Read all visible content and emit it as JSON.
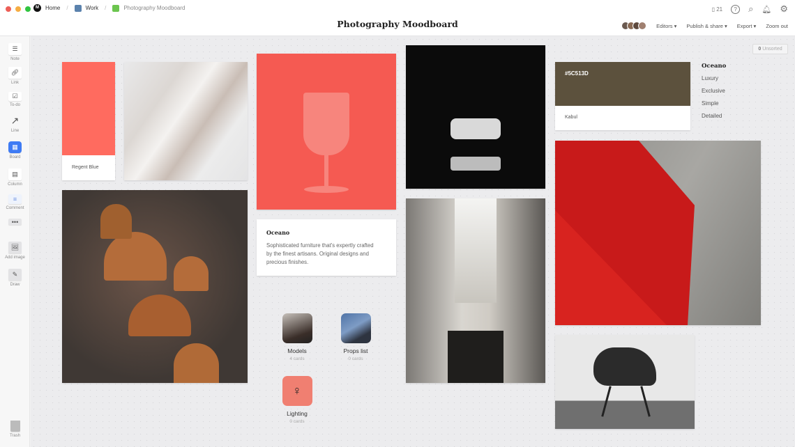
{
  "window": {
    "controls": [
      "close",
      "minimize",
      "maximize"
    ]
  },
  "breadcrumb": [
    {
      "label": "Home",
      "icon": "milanote-logo",
      "color": "#111111"
    },
    {
      "label": "Work",
      "icon": "board-square",
      "color": "#5b82ad"
    },
    {
      "label": "Photography Moodboard",
      "icon": "board-square",
      "color": "#6cc54f"
    }
  ],
  "header": {
    "title": "Photography Moodboard",
    "device_count": "21",
    "icons": [
      "mobile-icon",
      "help-icon",
      "search-icon",
      "bell-icon",
      "gear-icon"
    ],
    "menus": {
      "editors": "Editors",
      "publish": "Publish & share",
      "export": "Export",
      "zoom": "Zoom out"
    }
  },
  "sidebar": {
    "tools": [
      {
        "label": "Note",
        "icon": "note-icon"
      },
      {
        "label": "Link",
        "icon": "link-icon"
      },
      {
        "label": "To-do",
        "icon": "todo-icon"
      },
      {
        "label": "Line",
        "icon": "line-icon"
      },
      {
        "label": "Board",
        "icon": "board-icon"
      },
      {
        "label": "Column",
        "icon": "column-icon"
      },
      {
        "label": "Comment",
        "icon": "comment-icon"
      },
      {
        "label": "",
        "icon": "more-icon"
      },
      {
        "label": "Add image",
        "icon": "add-image-icon"
      },
      {
        "label": "Draw",
        "icon": "draw-icon"
      }
    ],
    "trash": "Trash"
  },
  "canvas": {
    "unsorted": {
      "count": "0",
      "label": "Unsorted"
    },
    "swatch1": {
      "name": "Regent Blue",
      "color": "#FF6B5F"
    },
    "swatch2": {
      "hex": "#5C513D",
      "name": "Kabul",
      "color": "#5C513D"
    },
    "note": {
      "title": "Oceano",
      "body": "Sophisticated furniture that's expertly crafted by the finest artisans. Original designs and precious finishes."
    },
    "tags": {
      "title": "Oceano",
      "items": [
        "Luxury",
        "Exclusive",
        "Simple",
        "Detailed"
      ]
    },
    "boards": [
      {
        "name": "Models",
        "count": "4 cards"
      },
      {
        "name": "Props list",
        "count": "0 cards"
      },
      {
        "name": "Lighting",
        "count": "0 cards"
      }
    ],
    "images": [
      "white-architecture-building",
      "copper-pendant-lamps",
      "red-wine-glass",
      "white-chair-on-black",
      "concrete-corridor",
      "red-chair-closeup",
      "black-eames-chair"
    ]
  }
}
